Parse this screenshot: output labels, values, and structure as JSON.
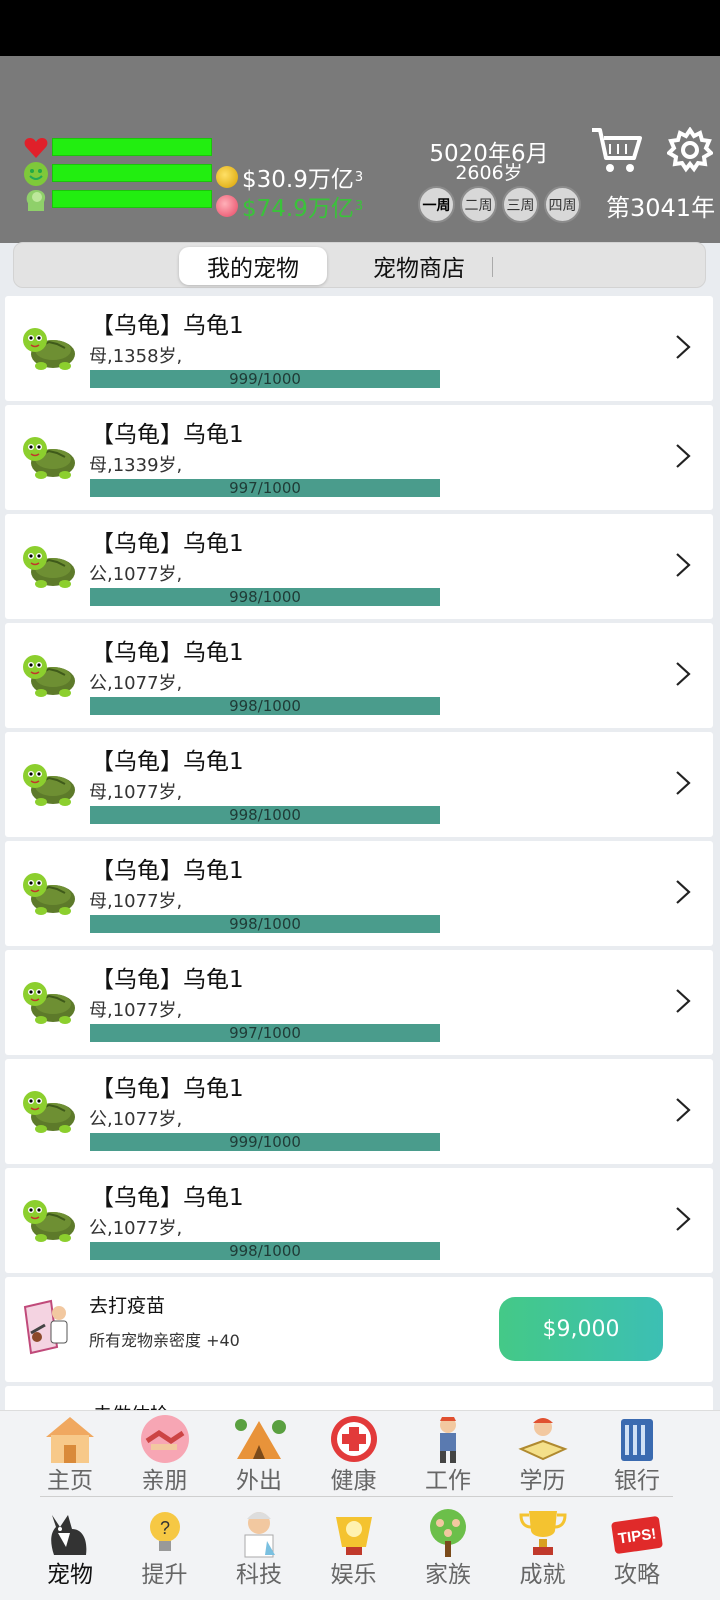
{
  "header": {
    "money_gold": "$30.9万亿",
    "money_gold_exp": "3",
    "money_pink": "$74.9万亿",
    "money_pink_exp": "3",
    "date": "5020年6月",
    "age": "2606岁",
    "weeks": [
      "一周",
      "二周",
      "三周",
      "四周"
    ],
    "active_week": "一周",
    "year": "第3041年",
    "stats": [
      {
        "icon": "heart-icon",
        "level": 1.0
      },
      {
        "icon": "happy-face-icon",
        "level": 1.0
      },
      {
        "icon": "brain-head-icon",
        "level": 1.0
      }
    ]
  },
  "tabs": {
    "my_pets": "我的宠物",
    "pet_shop": "宠物商店"
  },
  "pets": [
    {
      "title": "【乌龟】乌龟1",
      "info": "母,1358岁,",
      "progress": "999/1000",
      "level": 0.999
    },
    {
      "title": "【乌龟】乌龟1",
      "info": "母,1339岁,",
      "progress": "997/1000",
      "level": 0.997
    },
    {
      "title": "【乌龟】乌龟1",
      "info": "公,1077岁,",
      "progress": "998/1000",
      "level": 0.998
    },
    {
      "title": "【乌龟】乌龟1",
      "info": "公,1077岁,",
      "progress": "998/1000",
      "level": 0.998
    },
    {
      "title": "【乌龟】乌龟1",
      "info": "母,1077岁,",
      "progress": "998/1000",
      "level": 0.998
    },
    {
      "title": "【乌龟】乌龟1",
      "info": "母,1077岁,",
      "progress": "998/1000",
      "level": 0.998
    },
    {
      "title": "【乌龟】乌龟1",
      "info": "母,1077岁,",
      "progress": "997/1000",
      "level": 0.997
    },
    {
      "title": "【乌龟】乌龟1",
      "info": "公,1077岁,",
      "progress": "999/1000",
      "level": 0.999
    },
    {
      "title": "【乌龟】乌龟1",
      "info": "公,1077岁,",
      "progress": "998/1000",
      "level": 0.998
    }
  ],
  "vaccine": {
    "title": "去打疫苗",
    "desc": "所有宠物亲密度 +40",
    "price": "$9,000"
  },
  "partial": {
    "title": "去做体检"
  },
  "nav_top": [
    {
      "label": "主页",
      "icon": "home-icon"
    },
    {
      "label": "亲朋",
      "icon": "handshake-icon"
    },
    {
      "label": "外出",
      "icon": "camping-icon"
    },
    {
      "label": "健康",
      "icon": "health-cross-icon"
    },
    {
      "label": "工作",
      "icon": "worker-icon"
    },
    {
      "label": "学历",
      "icon": "study-icon"
    },
    {
      "label": "银行",
      "icon": "bank-icon"
    }
  ],
  "nav_bottom": [
    {
      "label": "宠物",
      "icon": "dog-icon"
    },
    {
      "label": "提升",
      "icon": "bulb-icon"
    },
    {
      "label": "科技",
      "icon": "scientist-icon"
    },
    {
      "label": "娱乐",
      "icon": "cup-icon"
    },
    {
      "label": "家族",
      "icon": "family-tree-icon"
    },
    {
      "label": "成就",
      "icon": "trophy-icon"
    },
    {
      "label": "攻略",
      "icon": "tips-icon"
    }
  ],
  "colors": {
    "header_bg": "#7a7a7a",
    "stat_bar": "#22ee10",
    "progress_bar": "#4a9c8c",
    "money_gold_text": "#ffffff",
    "money_pink_text": "#3ac33a",
    "button_gradient_start": "#44c987",
    "button_gradient_end": "#3cbfb4"
  }
}
